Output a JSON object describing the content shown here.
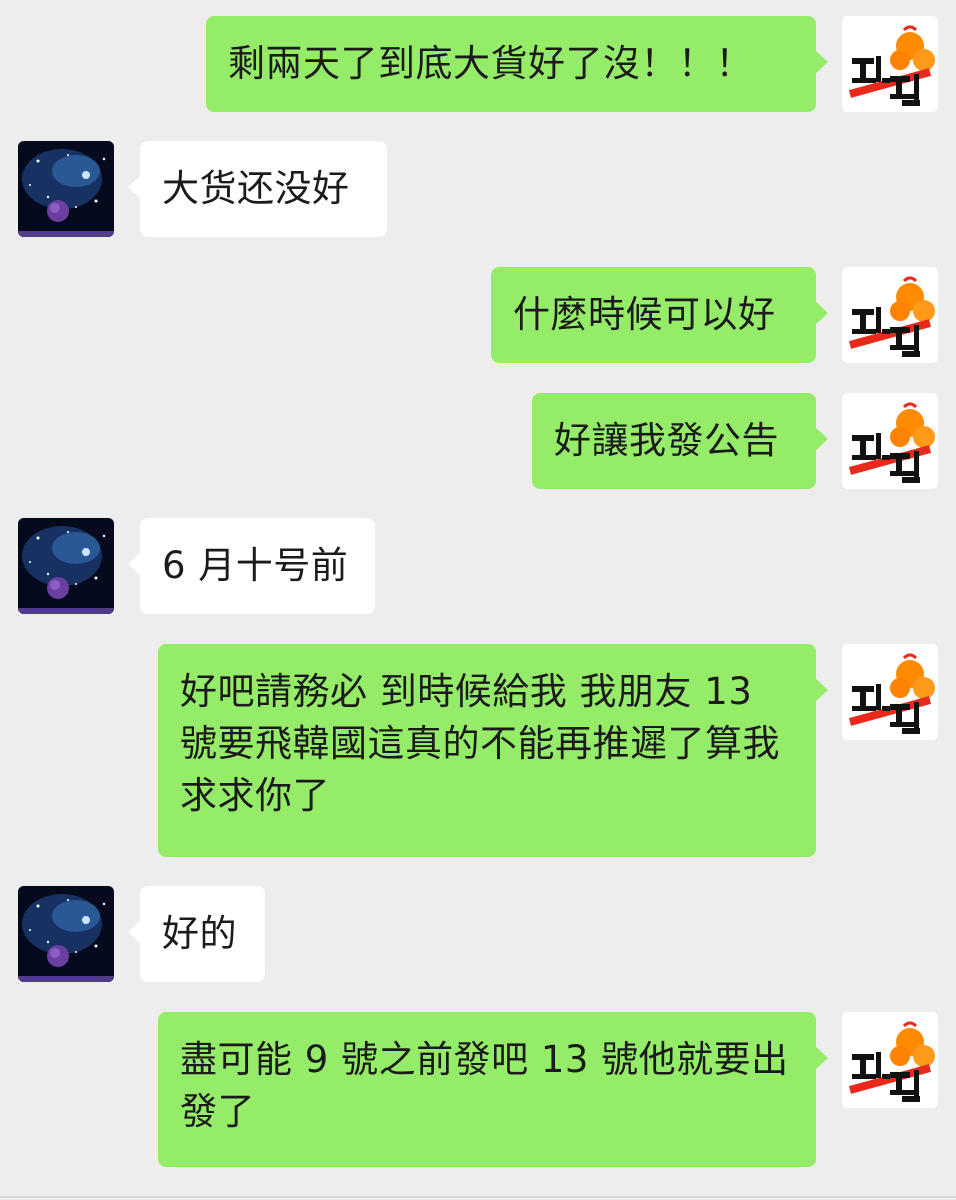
{
  "messages": [
    {
      "sender": "me",
      "text": "剩兩天了到底大貨好了沒！！！"
    },
    {
      "sender": "other",
      "text": "大货还没好"
    },
    {
      "sender": "me",
      "text": "什麼時候可以好"
    },
    {
      "sender": "me",
      "text": "好讓我發公告"
    },
    {
      "sender": "other",
      "text": "6 月十号前"
    },
    {
      "sender": "me",
      "text": "好吧請務必 到時候給我 我朋友 13 號要飛韓國這真的不能再推遲了算我求求你了"
    },
    {
      "sender": "other",
      "text": "好的"
    },
    {
      "sender": "me",
      "text": "盡可能 9 號之前發吧 13 號他就要出發了"
    }
  ],
  "avatars": {
    "me": {
      "logo_text": "젠잼",
      "icon": "orange-fruit-logo-icon",
      "colors": [
        "#ff8c00",
        "#e8291c",
        "#111111"
      ]
    },
    "other": {
      "icon": "starry-space-planet-icon",
      "colors": [
        "#3b6fb0",
        "#06081a",
        "#6b3fa0"
      ]
    }
  },
  "colors": {
    "background": "#ededed",
    "outgoing_bubble": "#95ec69",
    "incoming_bubble": "#ffffff",
    "text": "#1b1b1b"
  }
}
